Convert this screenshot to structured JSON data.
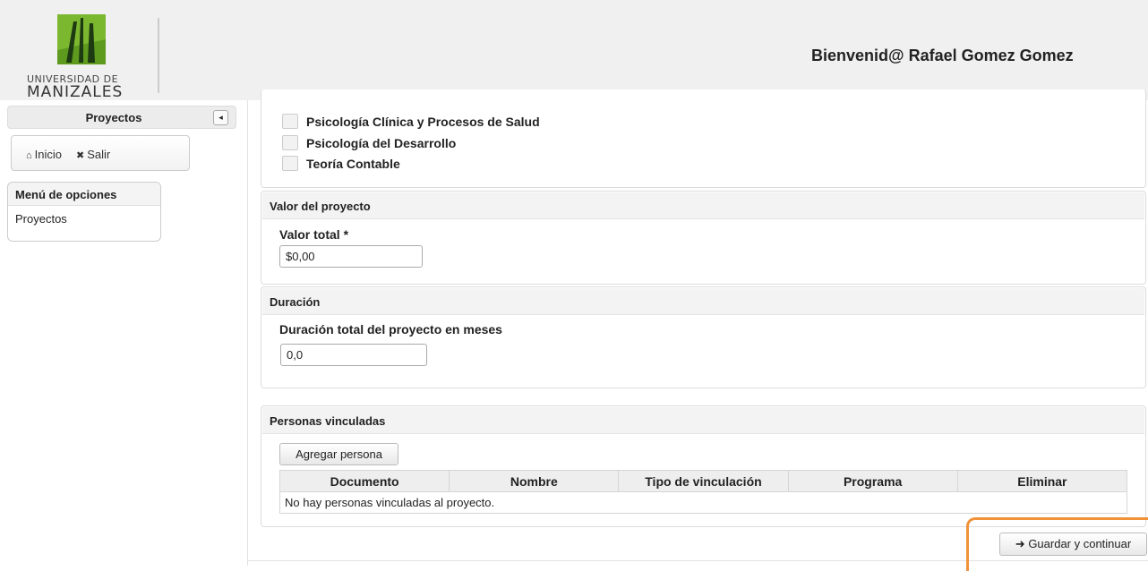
{
  "header": {
    "logo": {
      "line1": "UNIVERSIDAD DE",
      "line2": "MANIZALES"
    },
    "welcome": "Bienvenid@ Rafael Gomez Gomez"
  },
  "sidebar": {
    "title": "Proyectos",
    "collapse_glyph": "◂",
    "nav": {
      "home_label": "Inicio",
      "home_icon": "home-icon",
      "logout_label": "Salir",
      "logout_icon": "close-icon"
    },
    "menu": {
      "title": "Menú de opciones",
      "items": [
        "Proyectos"
      ]
    }
  },
  "areas": {
    "items": [
      "Psicología Clínica y Procesos de Salud",
      "Psicología del Desarrollo",
      "Teoría Contable"
    ]
  },
  "valor": {
    "title": "Valor del proyecto",
    "field_label": "Valor total *",
    "value": "$0,00"
  },
  "duracion": {
    "title": "Duración",
    "field_label": "Duración total del proyecto en meses",
    "value": "0,0"
  },
  "personas": {
    "title": "Personas vinculadas",
    "add_button": "Agregar persona",
    "columns": [
      "Documento",
      "Nombre",
      "Tipo de vinculación",
      "Programa",
      "Eliminar"
    ],
    "empty_message": "No hay personas vinculadas al proyecto."
  },
  "footer": {
    "save_button": "Guardar y continuar",
    "save_icon": "arrow-right-icon"
  },
  "colors": {
    "highlight": "#f0923a",
    "logo_green": "#7cb82f"
  }
}
